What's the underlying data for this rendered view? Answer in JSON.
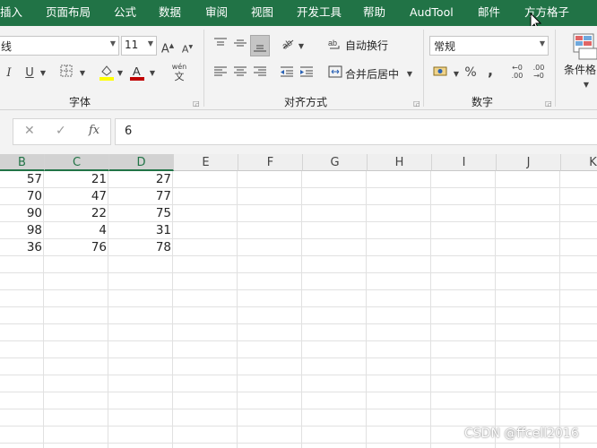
{
  "tabs": [
    "插入",
    "页面布局",
    "公式",
    "数据",
    "审阅",
    "视图",
    "开发工具",
    "帮助",
    "AudTool",
    "邮件",
    "方方格子"
  ],
  "font_group": {
    "font_name": "线",
    "font_size": "11",
    "label": "字体",
    "grow_icon": "A",
    "shrink_icon": "A",
    "italic": "I",
    "underline": "U",
    "wen_label": "wén",
    "wen_char": "文"
  },
  "align_group": {
    "label": "对齐方式",
    "wrap_text": "自动换行",
    "merge_center": "合并后居中"
  },
  "number_group": {
    "label": "数字",
    "format": "常规",
    "percent": "%",
    "comma": ","
  },
  "styles_group": {
    "conditional_format": "条件格"
  },
  "formula_bar": {
    "cancel": "✕",
    "enter": "✓",
    "fx": "fx",
    "value": "6"
  },
  "columns": [
    "B",
    "C",
    "D",
    "E",
    "F",
    "G",
    "H",
    "I",
    "J",
    "K"
  ],
  "rows": [
    [
      "57",
      "21",
      "27"
    ],
    [
      "70",
      "47",
      "77"
    ],
    [
      "90",
      "22",
      "75"
    ],
    [
      "98",
      "4",
      "31"
    ],
    [
      "36",
      "76",
      "78"
    ]
  ],
  "watermark": "CSDN @ffcell2016",
  "colors": {
    "ribbon_green": "#217346",
    "font_color_red": "#c00000",
    "fill_yellow": "#ffff00"
  }
}
